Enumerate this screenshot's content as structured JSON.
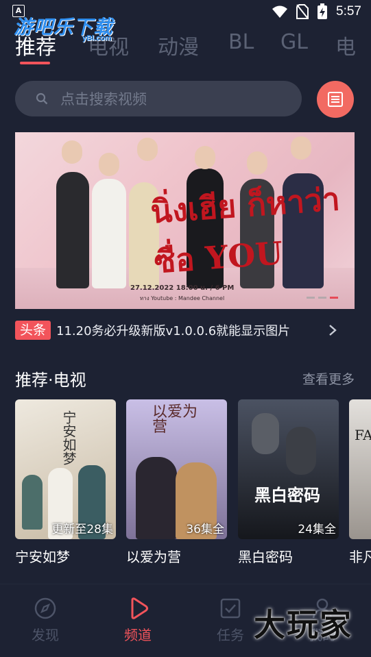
{
  "status_bar": {
    "time": "5:57",
    "a_icon": "A"
  },
  "watermark": {
    "text": "游吧乐下载",
    "sub": "yBl.com"
  },
  "tabs": [
    {
      "label": "推荐",
      "active": true
    },
    {
      "label": "电视",
      "active": false
    },
    {
      "label": "动漫",
      "active": false
    },
    {
      "label": "BL",
      "active": false
    },
    {
      "label": "GL",
      "active": false
    },
    {
      "label": "电",
      "active": false
    }
  ],
  "search": {
    "placeholder": "点击搜索视频"
  },
  "banner": {
    "title": "นิ่งเฮีย ก็หาว่าซื่อ YOU",
    "date": "27.12.2022 18:00 u. / 6 PM",
    "channel": "ทาง Youtube : Mandee Channel",
    "page_count": 3,
    "active_page": 3
  },
  "headline": {
    "tag": "头条",
    "text": "11.20务必升级新版v1.0.0.6就能显示图片"
  },
  "section": {
    "title": "推荐·电视",
    "more": "查看更多"
  },
  "cards": [
    {
      "title": "宁安如梦",
      "badge": "更新至28集",
      "poster_text": "宁安如梦",
      "color1": "#e9e3d6",
      "color2": "#c6b9a3"
    },
    {
      "title": "以爱为营",
      "badge": "36集全",
      "poster_text": "以爱为营",
      "color1": "#c4b8e0",
      "color2": "#6a5f7e"
    },
    {
      "title": "黑白密码",
      "badge": "24集全",
      "poster_text": "黑白密码",
      "color1": "#3b4250",
      "color2": "#1a1c22"
    },
    {
      "title": "非凡",
      "badge": "",
      "poster_text": "FA",
      "color1": "#d9d6d2",
      "color2": "#8a8580"
    }
  ],
  "bottom_nav": [
    {
      "label": "发现",
      "icon": "compass-icon",
      "active": false
    },
    {
      "label": "频道",
      "icon": "play-icon",
      "active": true
    },
    {
      "label": "任务",
      "icon": "task-check-icon",
      "active": false
    },
    {
      "label": "我的",
      "icon": "user-icon",
      "active": false
    }
  ],
  "corner_logo": "大玩家",
  "colors": {
    "accent": "#f2545b",
    "background": "#1d2233",
    "search_bg": "#3a3f50"
  }
}
